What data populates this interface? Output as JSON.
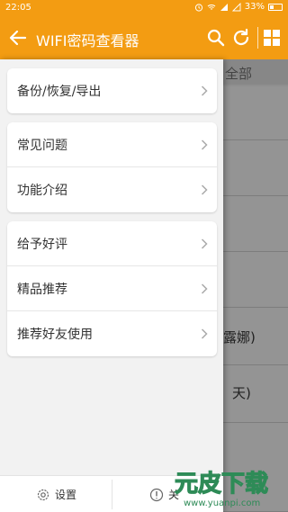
{
  "status_bar": {
    "time": "22:05",
    "battery": "33%"
  },
  "app_bar": {
    "title": "WIFI密码查看器",
    "icons": [
      "back-arrow-icon",
      "search-icon",
      "refresh-icon",
      "grid-icon"
    ]
  },
  "background": {
    "tab_label": "全部",
    "fragments": [
      "露娜)",
      "天)"
    ]
  },
  "drawer": {
    "groups": [
      {
        "items": [
          {
            "label": "备份/恢复/导出"
          }
        ]
      },
      {
        "items": [
          {
            "label": "常见问题"
          },
          {
            "label": "功能介绍"
          }
        ]
      },
      {
        "items": [
          {
            "label": "给予好评"
          },
          {
            "label": "精品推荐"
          },
          {
            "label": "推荐好友使用"
          }
        ]
      }
    ],
    "footer": {
      "settings_label": "设置",
      "about_label": "关"
    }
  },
  "watermark": {
    "brand": "元皮下载",
    "url": "www.yuanpi.com"
  },
  "colors": {
    "accent": "#f39c12",
    "drawer_bg": "#f2f2f2",
    "text": "#333333"
  }
}
